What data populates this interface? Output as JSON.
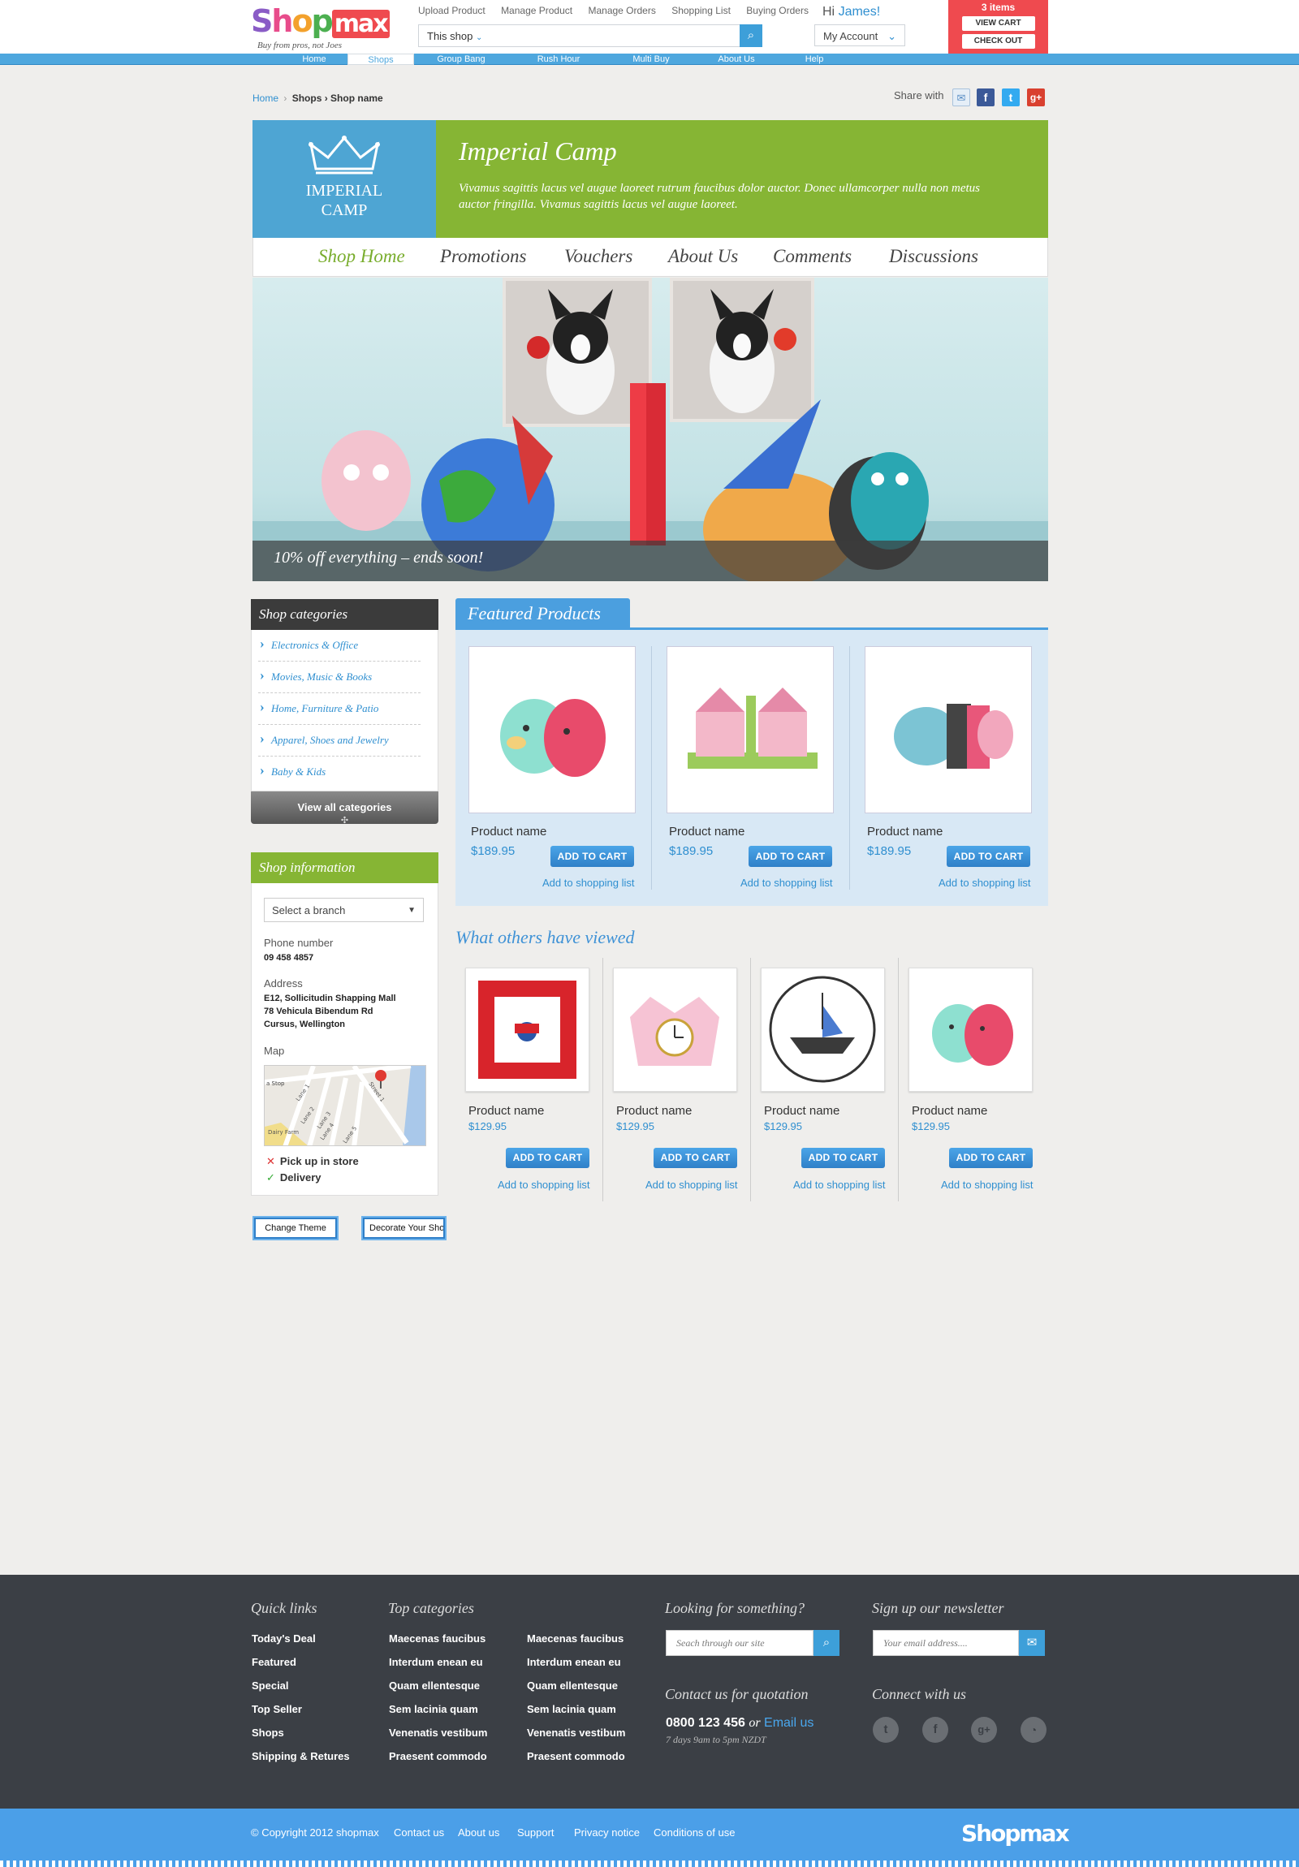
{
  "header": {
    "logo_text": "Shopmax",
    "tagline": "Buy from pros, not Joes",
    "top_links": [
      "Upload Product",
      "Manage Product",
      "Manage Orders",
      "Shopping List",
      "Buying Orders"
    ],
    "search_scope": "This shop",
    "greeting_prefix": "Hi",
    "user_name": "James!",
    "account_label": "My Account",
    "cart_items": "3 items",
    "view_cart": "VIEW CART",
    "check_out": "CHECK OUT",
    "nav": [
      {
        "label": "Home",
        "active": false
      },
      {
        "label": "Shops",
        "active": true
      },
      {
        "label": "Group Bang",
        "active": false
      },
      {
        "label": "Rush Hour",
        "active": false
      },
      {
        "label": "Multi Buy",
        "active": false
      },
      {
        "label": "About Us",
        "active": false
      },
      {
        "label": "Help",
        "active": false
      }
    ]
  },
  "breadcrumb": {
    "home": "Home",
    "sep": "›",
    "rest": "Shops › Shop name"
  },
  "share": {
    "label": "Share with",
    "icons": [
      "email-icon",
      "facebook-icon",
      "twitter-icon",
      "google-plus-icon"
    ]
  },
  "shop": {
    "logo_line1": "IMPERIAL",
    "logo_line2": "CAMP",
    "title": "Imperial Camp",
    "description": "Vivamus sagittis lacus vel augue laoreet rutrum faucibus dolor auctor. Donec ullamcorper nulla non metus auctor fringilla. Vivamus sagittis lacus vel augue laoreet.",
    "nav": [
      {
        "label": "Shop Home",
        "active": true
      },
      {
        "label": "Promotions",
        "active": false
      },
      {
        "label": "Vouchers",
        "active": false
      },
      {
        "label": "About Us",
        "active": false
      },
      {
        "label": "Comments",
        "active": false
      },
      {
        "label": "Discussions",
        "active": false
      }
    ],
    "hero_caption": "10% off everything – ends soon!"
  },
  "sidebar": {
    "categories_title": "Shop categories",
    "categories": [
      "Electronics & Office",
      "Movies, Music & Books",
      "Home, Furniture & Patio",
      "Apparel, Shoes and Jewelry",
      "Baby & Kids"
    ],
    "view_all": "View all categories",
    "info_title": "Shop information",
    "branch_placeholder": "Select a branch",
    "phone_label": "Phone number",
    "phone": "09 458 4857",
    "address_label": "Address",
    "address_lines": [
      "E12, Sollicitudin Shapping Mall",
      "78 Vehicula Bibendum Rd",
      "Cursus, Wellington"
    ],
    "map_label": "Map",
    "map_streets": [
      "a Stop",
      "Lane 1",
      "Lane 2",
      "Lane 3",
      "Lane 4",
      "Lane 5",
      "Street 1",
      "Dairy Farm"
    ],
    "pickup": "Pick up in store",
    "delivery": "Delivery",
    "pickup_available": false,
    "delivery_available": true,
    "change_theme": "Change Theme",
    "decorate": "Decorate Your Shop"
  },
  "featured": {
    "title": "Featured Products",
    "products": [
      {
        "name": "Product name",
        "price": "$189.95",
        "cart": "ADD TO CART",
        "list": "Add to shopping list"
      },
      {
        "name": "Product name",
        "price": "$189.95",
        "cart": "ADD TO CART",
        "list": "Add to shopping list"
      },
      {
        "name": "Product name",
        "price": "$189.95",
        "cart": "ADD TO CART",
        "list": "Add to shopping list"
      }
    ]
  },
  "viewed": {
    "title": "What others have viewed",
    "products": [
      {
        "name": "Product name",
        "price": "$129.95",
        "cart": "ADD TO CART",
        "list": "Add to shopping list"
      },
      {
        "name": "Product name",
        "price": "$129.95",
        "cart": "ADD TO CART",
        "list": "Add to shopping list"
      },
      {
        "name": "Product name",
        "price": "$129.95",
        "cart": "ADD TO CART",
        "list": "Add to shopping list"
      },
      {
        "name": "Product name",
        "price": "$129.95",
        "cart": "ADD TO CART",
        "list": "Add to shopping list"
      }
    ]
  },
  "footer": {
    "quick_links_title": "Quick links",
    "quick_links": [
      "Today's Deal",
      "Featured",
      "Special",
      "Top Seller",
      "Shops",
      "Shipping & Retures"
    ],
    "top_categories_title": "Top categories",
    "top_categories_a": [
      "Maecenas faucibus",
      "Interdum enean eu",
      "Quam ellentesque",
      "Sem lacinia quam",
      "Venenatis vestibum",
      "Praesent commodo"
    ],
    "top_categories_b": [
      "Maecenas faucibus",
      "Interdum enean eu",
      "Quam ellentesque",
      "Sem lacinia quam",
      "Venenatis vestibum",
      "Praesent commodo"
    ],
    "search_title": "Looking for something?",
    "search_placeholder": "Seach through our site",
    "contact_title": "Contact us for quotation",
    "phone": "0800 123 456",
    "or": "or",
    "email_link": "Email us",
    "hours": "7 days 9am to 5pm NZDT",
    "newsletter_title": "Sign up our newsletter",
    "newsletter_placeholder": "Your email address....",
    "connect_title": "Connect with us",
    "social_icons": [
      "twitter-icon",
      "facebook-icon",
      "google-plus-icon",
      "rss-icon"
    ]
  },
  "bottom": {
    "copyright": "© Copyright 2012 shopmax",
    "links": [
      "Contact us",
      "About us",
      "Support",
      "Privacy notice",
      "Conditions of use"
    ],
    "logo": "Shopmax"
  },
  "colors": {
    "brand_blue": "#4ea7de",
    "shop_green": "#86b534",
    "cart_red": "#ef4a4f",
    "footer_dark": "#3b3f45"
  }
}
